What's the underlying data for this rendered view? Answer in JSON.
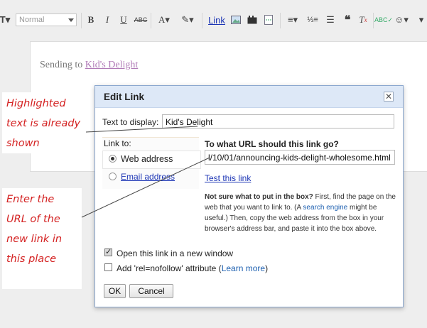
{
  "toolbar": {
    "font_family_value": "Normal",
    "link_label": "Link"
  },
  "editor": {
    "prefix": "Sending to",
    "link_text": "Kid's Delight"
  },
  "annotations": {
    "note1": [
      "Highlighted",
      "text is already",
      "shown"
    ],
    "note2": [
      "Enter the",
      "URL of the",
      "new link in",
      "this place"
    ]
  },
  "dialog": {
    "title": "Edit Link",
    "close_glyph": "✕",
    "text_to_display_label": "Text to display:",
    "text_to_display_value": "Kid's Delight",
    "link_to_label": "Link to:",
    "option_web": "Web address",
    "option_email": "Email address",
    "url_question": "To what URL should this link go?",
    "url_value": "l/10/01/announcing-kids-delight-wholesome.html",
    "test_link": "Test this link",
    "help_bold": "Not sure what to put in the box?",
    "help_1": " First, find the page on the web that you want to link to. (A ",
    "help_link": "search engine",
    "help_2": " might be useful.) Then, copy the web address from the box in your browser's address bar, and paste it into the box above.",
    "open_new_window": "Open this link in a new window",
    "open_new_window_checked": true,
    "nofollow_label": "Add 'rel=nofollow' attribute",
    "nofollow_checked": false,
    "learn_more": "Learn more",
    "ok": "OK",
    "cancel": "Cancel"
  },
  "colors": {
    "annotation_red": "#d42222",
    "dialog_title_bg": "#dde8f7",
    "link_blue": "#1c35b5",
    "visited_link": "#b07ab7"
  }
}
